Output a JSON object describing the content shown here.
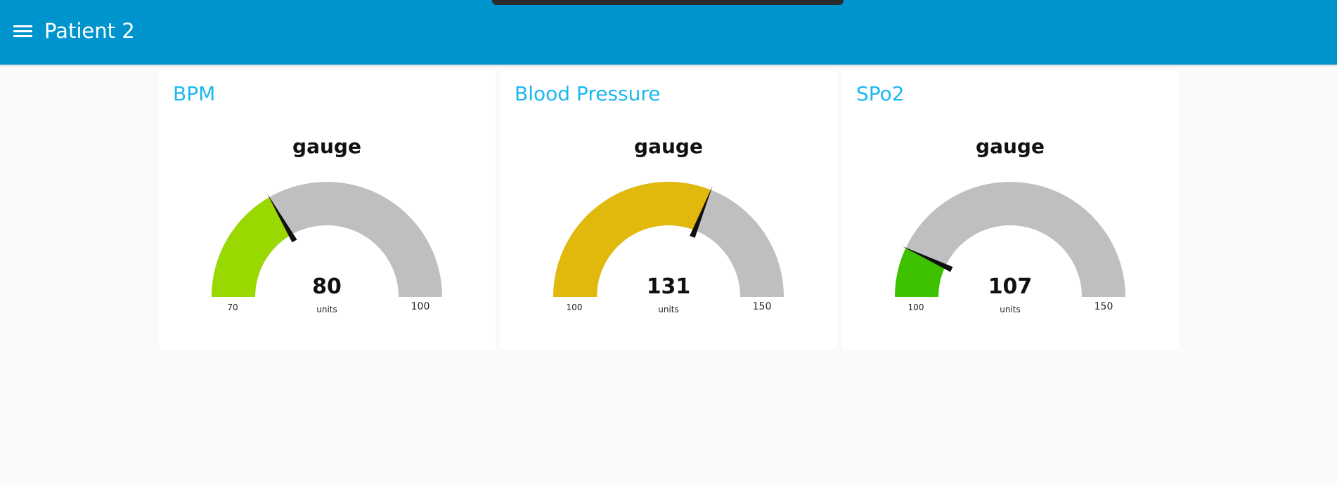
{
  "header": {
    "title": "Patient 2",
    "background_color": "#0094ce",
    "menu_icon": "hamburger-menu-icon"
  },
  "cards": [
    {
      "id": "bpm",
      "title": "BPM",
      "gauge": {
        "label": "gauge",
        "value": 80,
        "value_text": "80",
        "units": "units",
        "min": 70,
        "max": 100,
        "min_text": "70",
        "max_text": "100",
        "fill_color": "#99d800"
      }
    },
    {
      "id": "blood-pressure",
      "title": "Blood Pressure",
      "gauge": {
        "label": "gauge",
        "value": 131,
        "value_text": "131",
        "units": "units",
        "min": 100,
        "max": 150,
        "min_text": "100",
        "max_text": "150",
        "fill_color": "#e0b90c"
      }
    },
    {
      "id": "spo2",
      "title": "SPo2",
      "gauge": {
        "label": "gauge",
        "value": 107,
        "value_text": "107",
        "units": "units",
        "min": 100,
        "max": 150,
        "min_text": "100",
        "max_text": "150",
        "fill_color": "#3ec200"
      }
    }
  ],
  "colors": {
    "card_title": "#1bb7f0",
    "gauge_track": "#bfbfbf",
    "needle": "#111111",
    "page_background": "#fafafa"
  }
}
